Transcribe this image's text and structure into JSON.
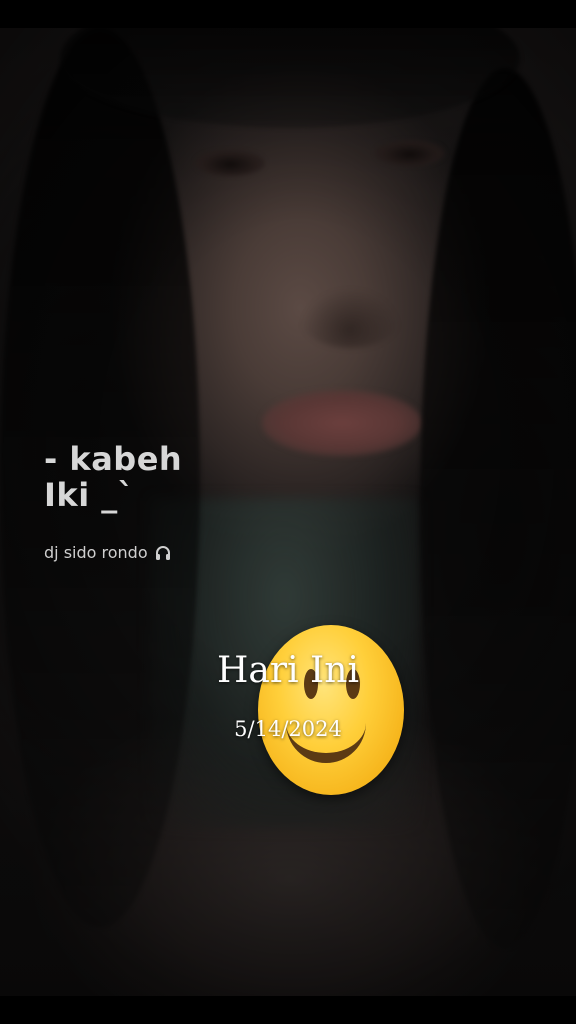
{
  "overlay": {
    "title_line1": "- kabeh",
    "title_line2": "Iki _`",
    "subtitle": "dj sido rondo",
    "subtitle_icon": "headphones-icon"
  },
  "center": {
    "title": "Hari Ini",
    "date": "5/14/2024",
    "emoji": "slightly-smiling-face"
  },
  "colors": {
    "background": "#000000",
    "text": "#ffffff",
    "emoji_yellow": "#ffcf3a"
  }
}
